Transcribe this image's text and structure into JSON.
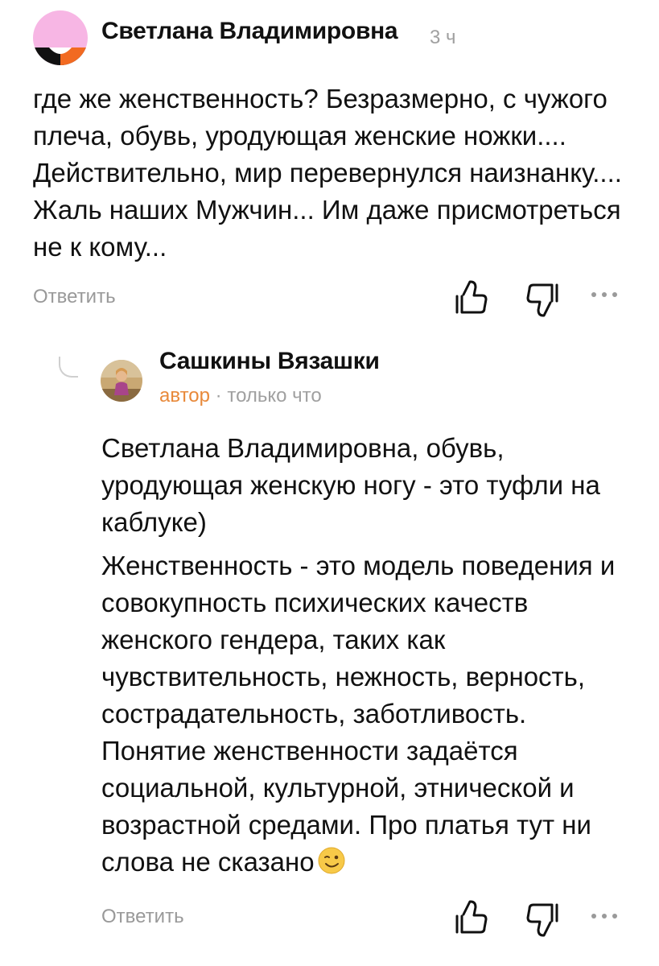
{
  "comments": [
    {
      "author": "Светлана Владимировна",
      "time": "3 ч",
      "avatar_icon": "avatar-pink-black-orange",
      "text": "где же женственность? Безразмерно, с чужого плеча, обувь, уродующая женские ножки.... Действительно, мир перевернулся наизнанку.... Жаль наших Мужчин... Им даже присмотреться не к кому...",
      "reply_label": "Ответить",
      "like_icon": "thumbs-up-icon",
      "dislike_icon": "thumbs-down-icon",
      "more_icon": "more-dots-icon"
    }
  ],
  "reply": {
    "author": "Сашкины Вязашки",
    "badge": "автор",
    "separator": "·",
    "time": "только что",
    "avatar_icon": "avatar-photo",
    "paragraph1": "Светлана Владимировна, обувь, уродующая женскую ногу - это туфли на каблуке)",
    "paragraph2": "Женственность - это модель поведения и совокупность психических качеств женского гендера, таких как чувствительность, нежность, верность, сострадательность, заботливость. Понятие женственности задаётся социальной, культурной, этнической и возрастной средами. Про платья тут ни слова не сказано",
    "emoji_icon": "winking-face-emoji",
    "reply_label": "Ответить",
    "like_icon": "thumbs-up-icon",
    "dislike_icon": "thumbs-down-icon",
    "more_icon": "more-dots-icon"
  },
  "colors": {
    "text": "#111111",
    "muted": "#999999",
    "author_badge": "#e8893a",
    "avatar_pink": "#f7b6e4",
    "avatar_orange": "#f26a21",
    "avatar_black": "#111111"
  }
}
